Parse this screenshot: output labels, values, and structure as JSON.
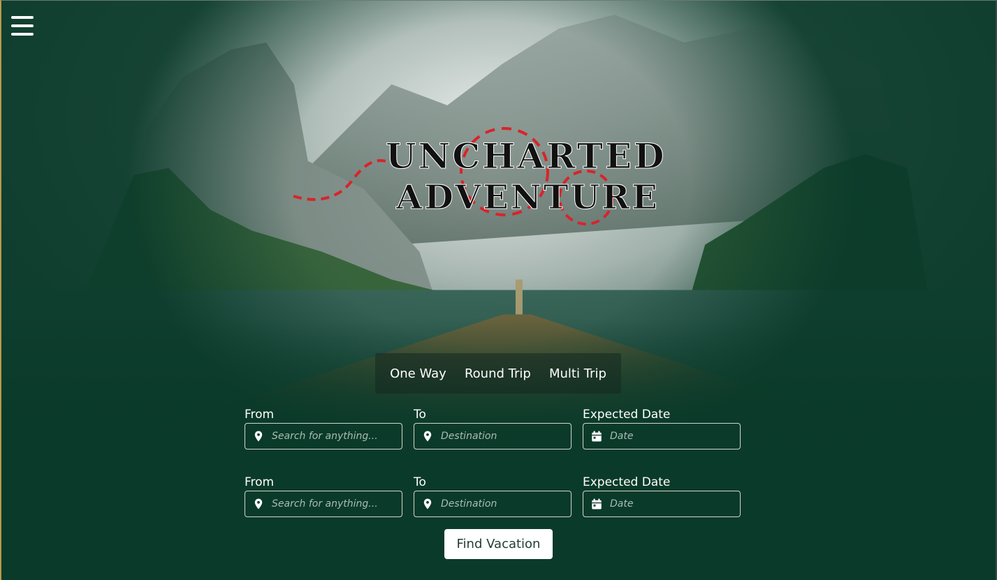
{
  "brand": {
    "line1": "UNCHARTED",
    "line2": "ADVENTURE"
  },
  "tabs": [
    {
      "label": "One Way"
    },
    {
      "label": "Round Trip"
    },
    {
      "label": "Multi Trip"
    }
  ],
  "trips": [
    {
      "from_label": "From",
      "from_placeholder": "Search for anything...",
      "to_label": "To",
      "to_placeholder": "Destination",
      "date_label": "Expected Date",
      "date_placeholder": "Date"
    },
    {
      "from_label": "From",
      "from_placeholder": "Search for anything...",
      "to_label": "To",
      "to_placeholder": "Destination",
      "date_label": "Expected Date",
      "date_placeholder": "Date"
    }
  ],
  "find_button": "Find Vacation",
  "colors": {
    "background": "#0b3a2a",
    "accent_red": "#d8242a",
    "button_text": "#1f3d30"
  },
  "icons": {
    "menu": "hamburger-menu-icon",
    "location": "map-pin-icon",
    "calendar": "calendar-icon"
  }
}
